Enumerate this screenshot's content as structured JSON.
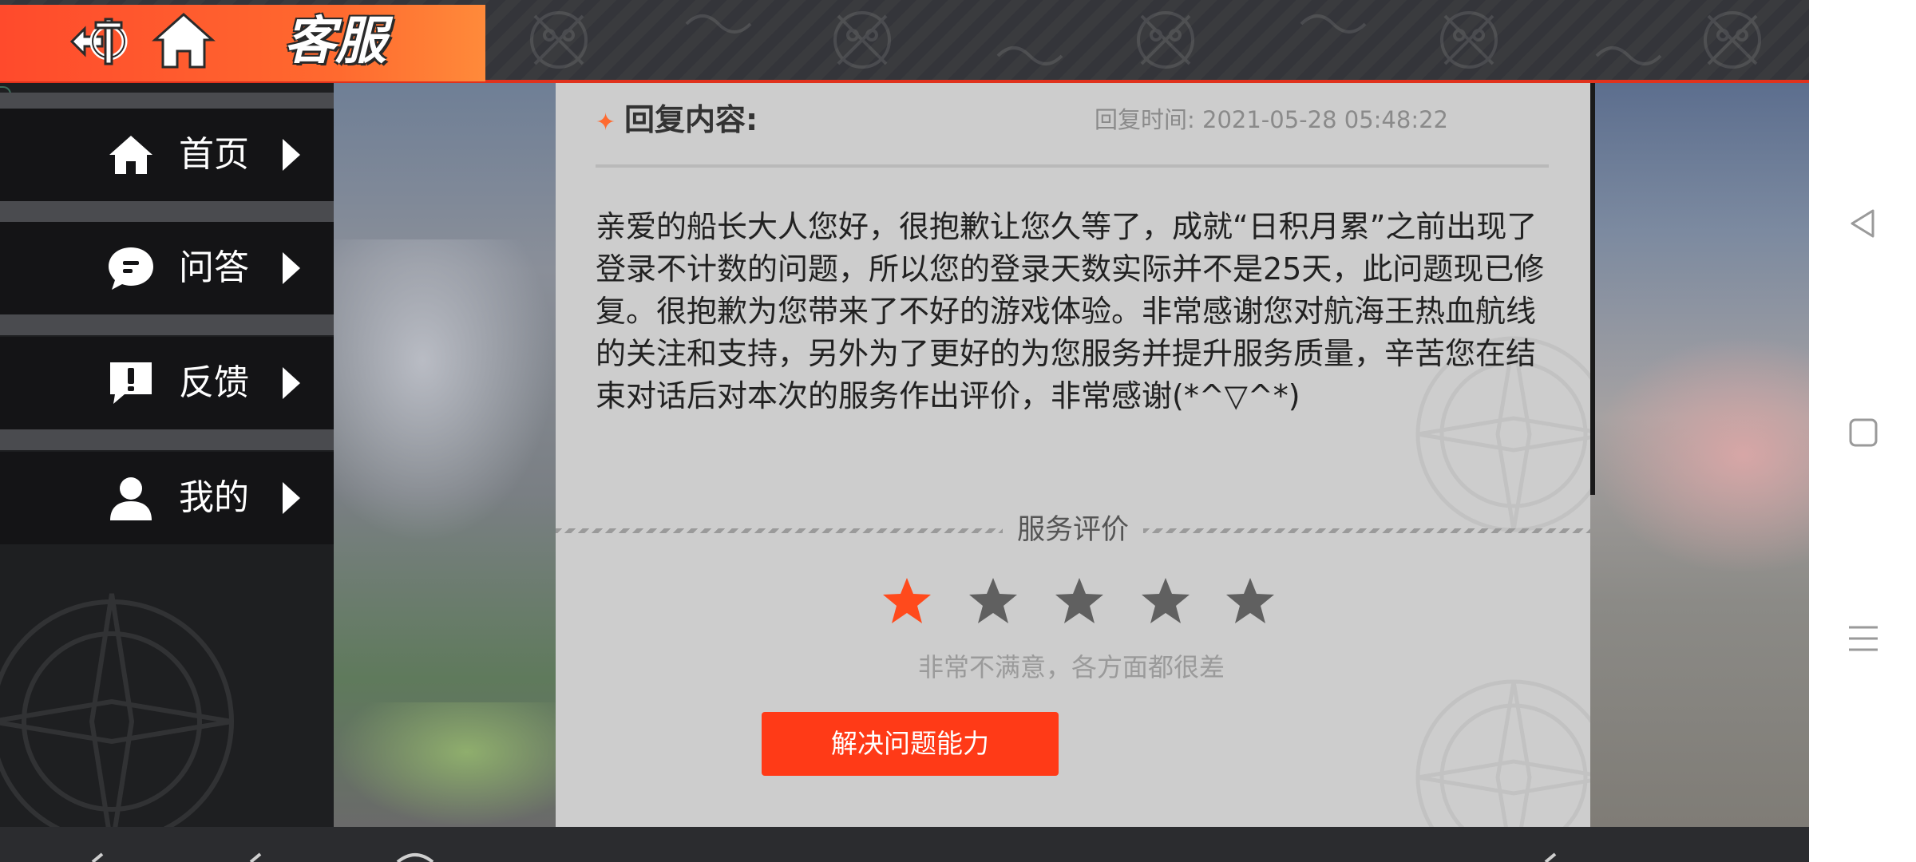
{
  "header": {
    "title": "客服",
    "back_icon": "anchor-back-icon",
    "home_icon": "home-icon",
    "accent_color": "#ff5a2c"
  },
  "sidebar": {
    "items": [
      {
        "label": "首页",
        "icon": "home-icon"
      },
      {
        "label": "问答",
        "icon": "chat-bubble-icon"
      },
      {
        "label": "反馈",
        "icon": "exclamation-bubble-icon"
      },
      {
        "label": "我的",
        "icon": "user-icon"
      }
    ]
  },
  "reply": {
    "title": "回复内容:",
    "time": "回复时间: 2021-05-28 05:48:22",
    "body": "亲爱的船长大人您好，很抱歉让您久等了，成就“日积月累”之前出现了登录不计数的问题，所以您的登录天数实际并不是25天，此问题现已修复。很抱歉为您带来了不好的游戏体验。非常感谢您对航海王热血航线的关注和支持，另外为了更好的为您服务并提升服务质量，辛苦您在结束对话后对本次的服务作出评价，非常感谢(*^▽^*)"
  },
  "evaluation": {
    "title": "服务评价",
    "rating": 1,
    "max_rating": 5,
    "rating_text": "非常不满意，各方面都很差",
    "tag_button": "解决问题能力",
    "active_star_color": "#ff4a1c",
    "inactive_star_color": "#606060"
  },
  "android_nav": {
    "back_icon": "nav-back-icon",
    "home_icon": "nav-home-icon",
    "menu_icon": "nav-menu-icon"
  }
}
